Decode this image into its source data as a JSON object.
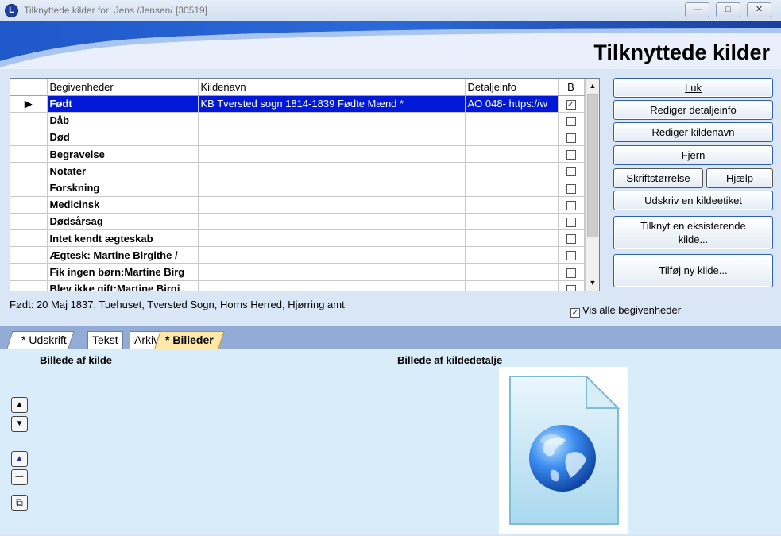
{
  "window": {
    "title": "Tilknyttede kilder for: Jens /Jensen/ [30519]",
    "app_icon": "L"
  },
  "banner": {
    "title": "Tilknyttede kilder"
  },
  "grid": {
    "columns": [
      "Begivenheder",
      "Kildenavn",
      "Detaljeinfo",
      "B"
    ],
    "rows": [
      {
        "event": "Født",
        "source": "KB Tversted sogn 1814-1839 Fødte Mænd *",
        "detail": "AO 048- https://w",
        "checked": true,
        "selected": true
      },
      {
        "event": "Dåb",
        "source": "",
        "detail": "",
        "checked": false,
        "selected": false
      },
      {
        "event": "Død",
        "source": "",
        "detail": "",
        "checked": false,
        "selected": false
      },
      {
        "event": "Begravelse",
        "source": "",
        "detail": "",
        "checked": false,
        "selected": false
      },
      {
        "event": "Notater",
        "source": "",
        "detail": "",
        "checked": false,
        "selected": false
      },
      {
        "event": "Forskning",
        "source": "",
        "detail": "",
        "checked": false,
        "selected": false
      },
      {
        "event": "Medicinsk",
        "source": "",
        "detail": "",
        "checked": false,
        "selected": false
      },
      {
        "event": "Dødsårsag",
        "source": "",
        "detail": "",
        "checked": false,
        "selected": false
      },
      {
        "event": "Intet kendt ægteskab",
        "source": "",
        "detail": "",
        "checked": false,
        "selected": false
      },
      {
        "event": "Ægtesk: Martine Birgithe /",
        "source": "",
        "detail": "",
        "checked": false,
        "selected": false
      },
      {
        "event": "Fik ingen børn:Martine Birg",
        "source": "",
        "detail": "",
        "checked": false,
        "selected": false
      },
      {
        "event": "Blev ikke gift:Martine Birgi",
        "source": "",
        "detail": "",
        "checked": false,
        "selected": false
      }
    ],
    "check_mark": "✓",
    "scroll_up": "▲",
    "scroll_down": "▼",
    "row_indicator": "▶"
  },
  "buttons": {
    "luk": "Luk",
    "rediger_detaljeinfo": "Rediger detaljeinfo",
    "rediger_kildenavn": "Rediger kildenavn",
    "fjern": "Fjern",
    "skriftstorrelse": "Skriftstørrelse",
    "hjaelp": "Hjælp",
    "udskriv": "Udskriv en kildeetiket",
    "tilknyt_line1": "Tilknyt en eksisterende",
    "tilknyt_line2": "kilde...",
    "tilfoej": "Tilføj ny kilde..."
  },
  "status_text": "Født: 20 Maj 1837, Tuehuset, Tversted Sogn, Horns Herred, Hjørring amt",
  "vis_alle": {
    "label": "Vis alle begivenheder",
    "checked": true
  },
  "tabs": [
    "* Udskrift",
    "Tekst",
    "Arkiv",
    "* Billeder"
  ],
  "active_tab": "* Billeder",
  "lower": {
    "left_label": "Billede af kilde",
    "right_label": "Billede af kildedetalje",
    "image_icon": "globe-document-icon"
  },
  "colors": {
    "selection": "#0019d8",
    "active_tab": "#ffe8a8",
    "button_border": "#2f5fb3"
  }
}
